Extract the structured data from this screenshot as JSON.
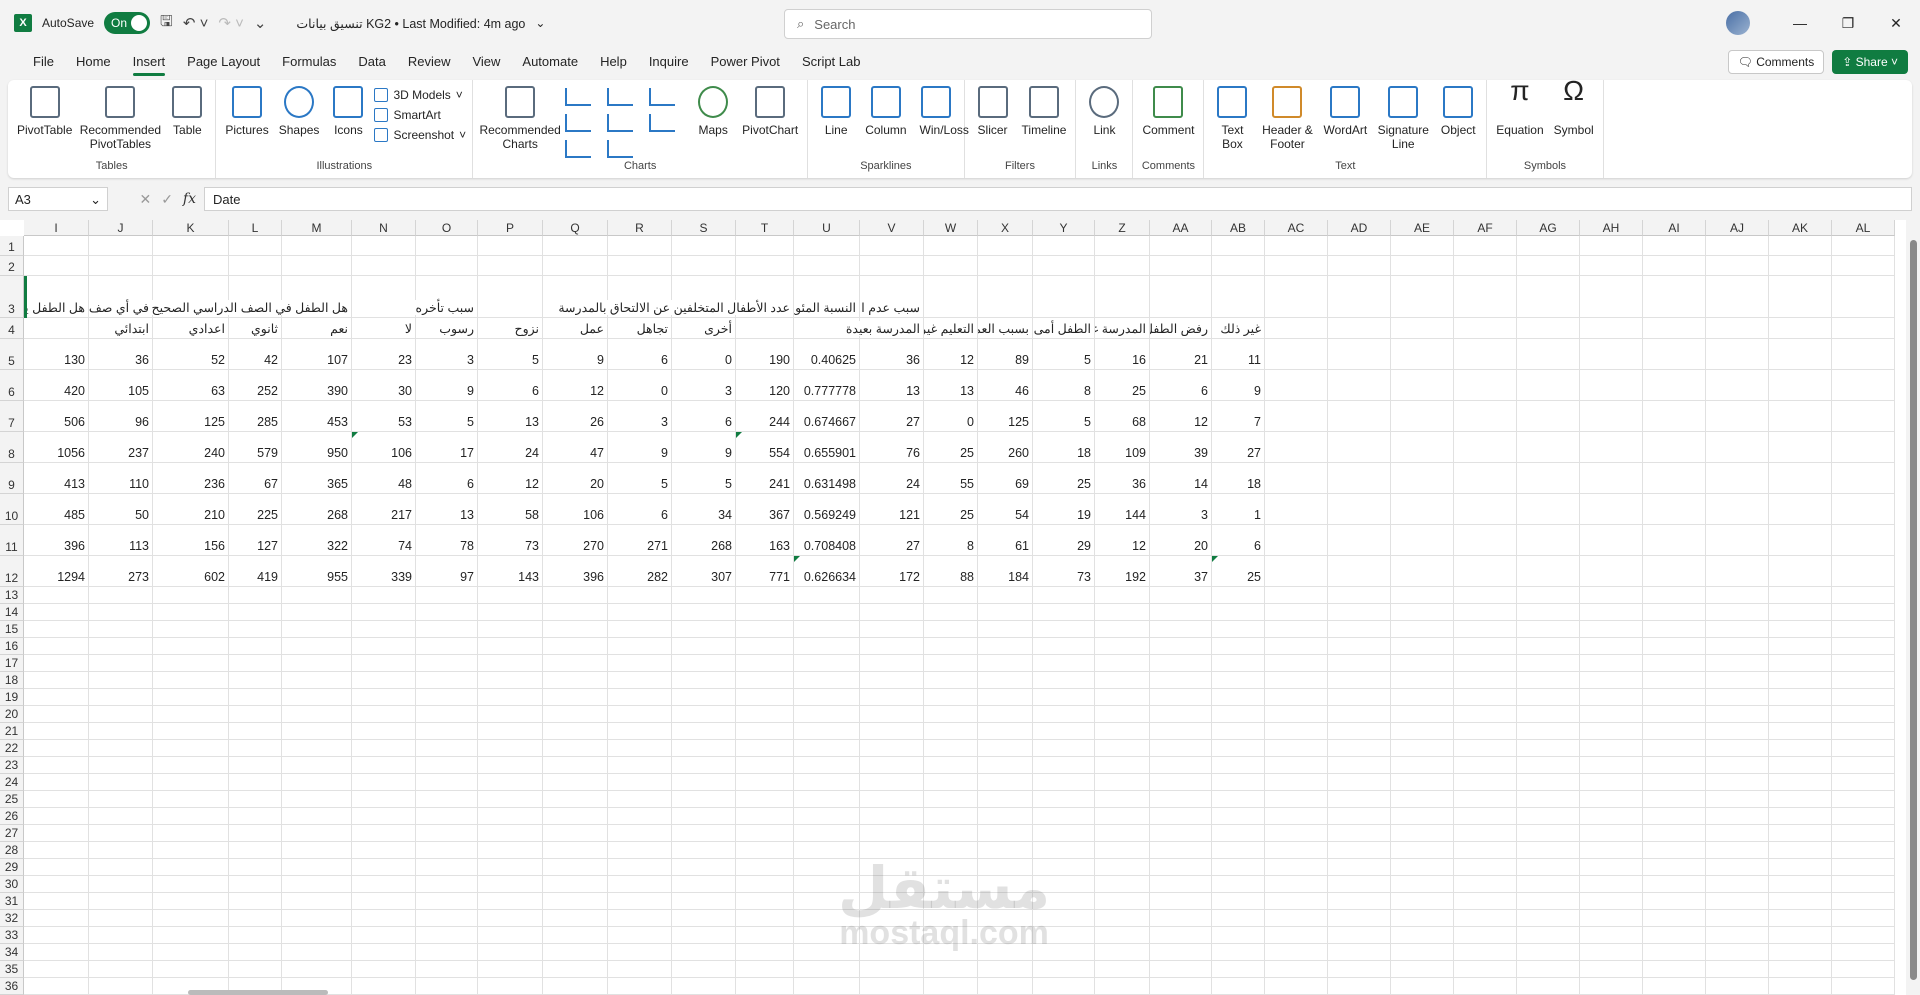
{
  "titlebar": {
    "app_icon": "excel-logo",
    "autosave_label": "AutoSave",
    "autosave_state": "On",
    "doc_title": "تنسيق بيانات  KG2 • Last Modified: 4m ago",
    "search_placeholder": "Search"
  },
  "menu": {
    "tabs": [
      "File",
      "Home",
      "Insert",
      "Page Layout",
      "Formulas",
      "Data",
      "Review",
      "View",
      "Automate",
      "Help",
      "Inquire",
      "Power Pivot",
      "Script Lab"
    ],
    "active": "Insert",
    "comments_label": "Comments",
    "share_label": "Share"
  },
  "ribbon": {
    "tables": {
      "label": "Tables",
      "items": [
        "PivotTable",
        "Recommended PivotTables",
        "Table"
      ]
    },
    "illustrations": {
      "label": "Illustrations",
      "items": [
        "Pictures",
        "Shapes",
        "Icons"
      ],
      "small": [
        "3D Models",
        "SmartArt",
        "Screenshot"
      ]
    },
    "charts": {
      "label": "Charts",
      "items": [
        "Recommended Charts",
        "Maps",
        "PivotChart"
      ]
    },
    "sparklines": {
      "label": "Sparklines",
      "items": [
        "Line",
        "Column",
        "Win/Loss"
      ]
    },
    "filters": {
      "label": "Filters",
      "items": [
        "Slicer",
        "Timeline"
      ]
    },
    "links": {
      "label": "Links",
      "items": [
        "Link"
      ]
    },
    "comments": {
      "label": "Comments",
      "items": [
        "Comment"
      ]
    },
    "text": {
      "label": "Text",
      "items": [
        "Text Box",
        "Header & Footer",
        "WordArt",
        "Signature Line",
        "Object"
      ]
    },
    "symbols": {
      "label": "Symbols",
      "items": [
        "Equation",
        "Symbol"
      ]
    }
  },
  "formula_bar": {
    "name_box": "A3",
    "formula": "Date"
  },
  "sheet": {
    "columns": [
      "I",
      "J",
      "K",
      "L",
      "M",
      "N",
      "O",
      "P",
      "Q",
      "R",
      "S",
      "T",
      "U",
      "V",
      "W",
      "X",
      "Y",
      "Z",
      "AA",
      "AB",
      "AC",
      "AD",
      "AE",
      "AF",
      "AG",
      "AH",
      "AI",
      "AJ",
      "AK",
      "AL"
    ],
    "header_row3": {
      "I": "هل الطفل يذهب",
      "J": "في أي صف",
      "M": "هل الطفل في الصف الدراسي الصحيح",
      "O": "سبب تأخره",
      "T": "عدد الأطفال المتخلفين عن الالتحاق بالمدرسة",
      "U": "النسبة المئوية",
      "V": "سبب عدم الالتحاق"
    },
    "header_row4": {
      "J": "ابتدائي",
      "K": "اعدادي",
      "L": "ثانوي",
      "M": "نعم",
      "N": "لا",
      "O": "رسوب",
      "P": "نزوح",
      "Q": "عمل",
      "R": "تجاهل",
      "S": "أخرى",
      "V": "المدرسة بعيدة",
      "W": "التعليم غير",
      "X": "بسبب العمل",
      "Y": "الطفل أمى",
      "Z": "المدرسة غير",
      "AA": "رفض الطفل",
      "AB": "غير ذلك"
    },
    "rows": [
      [
        "130",
        "36",
        "52",
        "42",
        "107",
        "23",
        "3",
        "5",
        "9",
        "6",
        "0",
        "190",
        "0.40625",
        "36",
        "12",
        "89",
        "5",
        "16",
        "21",
        "11"
      ],
      [
        "420",
        "105",
        "63",
        "252",
        "390",
        "30",
        "9",
        "6",
        "12",
        "0",
        "3",
        "120",
        "0.777778",
        "13",
        "13",
        "46",
        "8",
        "25",
        "6",
        "9"
      ],
      [
        "506",
        "96",
        "125",
        "285",
        "453",
        "53",
        "5",
        "13",
        "26",
        "3",
        "6",
        "244",
        "0.674667",
        "27",
        "0",
        "125",
        "5",
        "68",
        "12",
        "7"
      ],
      [
        "1056",
        "237",
        "240",
        "579",
        "950",
        "106",
        "17",
        "24",
        "47",
        "9",
        "9",
        "554",
        "0.655901",
        "76",
        "25",
        "260",
        "18",
        "109",
        "39",
        "27"
      ],
      [
        "413",
        "110",
        "236",
        "67",
        "365",
        "48",
        "6",
        "12",
        "20",
        "5",
        "5",
        "241",
        "0.631498",
        "24",
        "55",
        "69",
        "25",
        "36",
        "14",
        "18"
      ],
      [
        "485",
        "50",
        "210",
        "225",
        "268",
        "217",
        "13",
        "58",
        "106",
        "6",
        "34",
        "367",
        "0.569249",
        "121",
        "25",
        "54",
        "19",
        "144",
        "3",
        "1"
      ],
      [
        "396",
        "113",
        "156",
        "127",
        "322",
        "74",
        "78",
        "73",
        "270",
        "271",
        "268",
        "163",
        "0.708408",
        "27",
        "8",
        "61",
        "29",
        "12",
        "20",
        "6"
      ],
      [
        "1294",
        "273",
        "602",
        "419",
        "955",
        "339",
        "97",
        "143",
        "396",
        "282",
        "307",
        "771",
        "0.626634",
        "172",
        "88",
        "184",
        "73",
        "192",
        "37",
        "25"
      ]
    ],
    "row_numbers_last": 36
  },
  "watermark": {
    "arabic": "مستقل",
    "latin": "mostaql.com"
  },
  "colors": {
    "accent": "#107c41"
  }
}
